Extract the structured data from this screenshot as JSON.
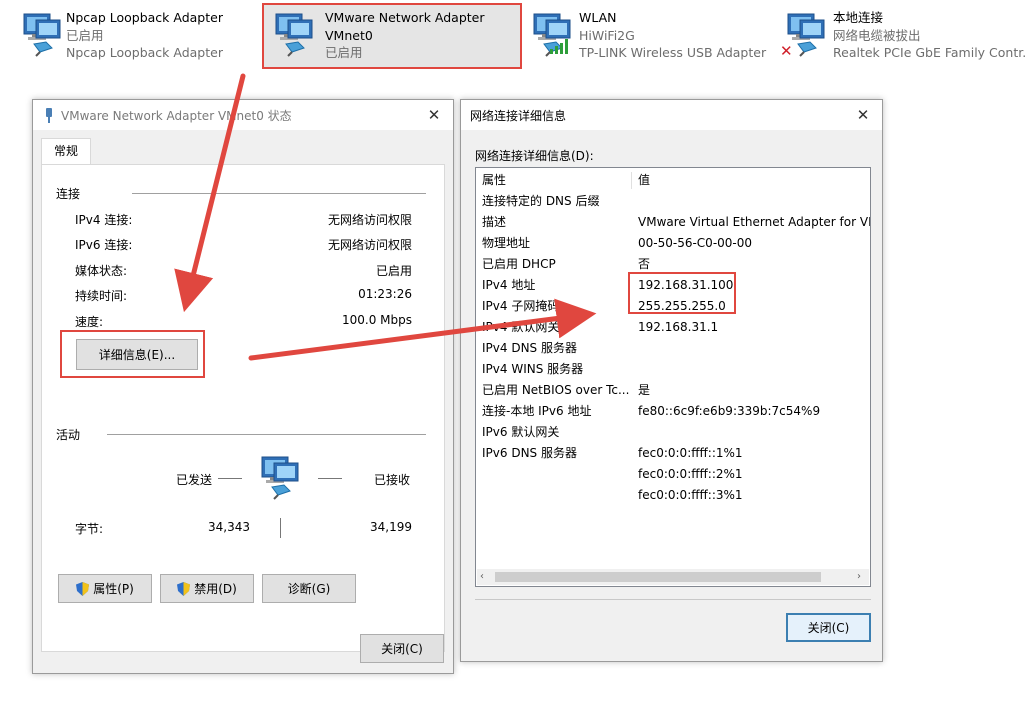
{
  "adapters": [
    {
      "name": "Npcap Loopback Adapter",
      "status": "已启用",
      "device": "Npcap Loopback Adapter"
    },
    {
      "name": "VMware Network Adapter",
      "name2": "VMnet0",
      "status": "已启用"
    },
    {
      "name": "WLAN",
      "status": "HiWiFi2G",
      "device": "TP-LINK Wireless USB Adapter"
    },
    {
      "name": "本地连接",
      "status": "网络电缆被拔出",
      "device": "Realtek PCIe GbE Family Contr..."
    }
  ],
  "status_dialog": {
    "title": "VMware Network Adapter VMnet0 状态",
    "tab": "常规",
    "connection_label": "连接",
    "rows": [
      {
        "label": "IPv4 连接:",
        "value": "无网络访问权限"
      },
      {
        "label": "IPv6 连接:",
        "value": "无网络访问权限"
      },
      {
        "label": "媒体状态:",
        "value": "已启用"
      },
      {
        "label": "持续时间:",
        "value": "01:23:26"
      },
      {
        "label": "速度:",
        "value": "100.0 Mbps"
      }
    ],
    "details_button": "详细信息(E)...",
    "activity_label": "活动",
    "sent_label": "已发送",
    "received_label": "已接收",
    "bytes_label": "字节:",
    "bytes_sent": "34,343",
    "bytes_received": "34,199",
    "properties_button": "属性(P)",
    "disable_button": "禁用(D)",
    "diagnose_button": "诊断(G)",
    "close_button": "关闭(C)"
  },
  "details_dialog": {
    "title": "网络连接详细信息",
    "list_label": "网络连接详细信息(D):",
    "col_property": "属性",
    "col_value": "值",
    "rows": [
      {
        "k": "连接特定的 DNS 后缀",
        "v": ""
      },
      {
        "k": "描述",
        "v": "VMware Virtual Ethernet Adapter for VM"
      },
      {
        "k": "物理地址",
        "v": "00-50-56-C0-00-00"
      },
      {
        "k": "已启用 DHCP",
        "v": "否"
      },
      {
        "k": "IPv4 地址",
        "v": "192.168.31.100"
      },
      {
        "k": "IPv4 子网掩码",
        "v": "255.255.255.0"
      },
      {
        "k": "IPv4 默认网关",
        "v": "192.168.31.1"
      },
      {
        "k": "IPv4 DNS 服务器",
        "v": ""
      },
      {
        "k": "IPv4 WINS 服务器",
        "v": ""
      },
      {
        "k": "已启用 NetBIOS over Tc...",
        "v": "是"
      },
      {
        "k": "连接-本地 IPv6 地址",
        "v": "fe80::6c9f:e6b9:339b:7c54%9"
      },
      {
        "k": "IPv6 默认网关",
        "v": ""
      },
      {
        "k": "IPv6 DNS 服务器",
        "v": "fec0:0:0:ffff::1%1"
      },
      {
        "k": "",
        "v": "fec0:0:0:ffff::2%1"
      },
      {
        "k": "",
        "v": "fec0:0:0:ffff::3%1"
      }
    ],
    "close_button": "关闭(C)"
  },
  "annotation_color": "#e0473f"
}
